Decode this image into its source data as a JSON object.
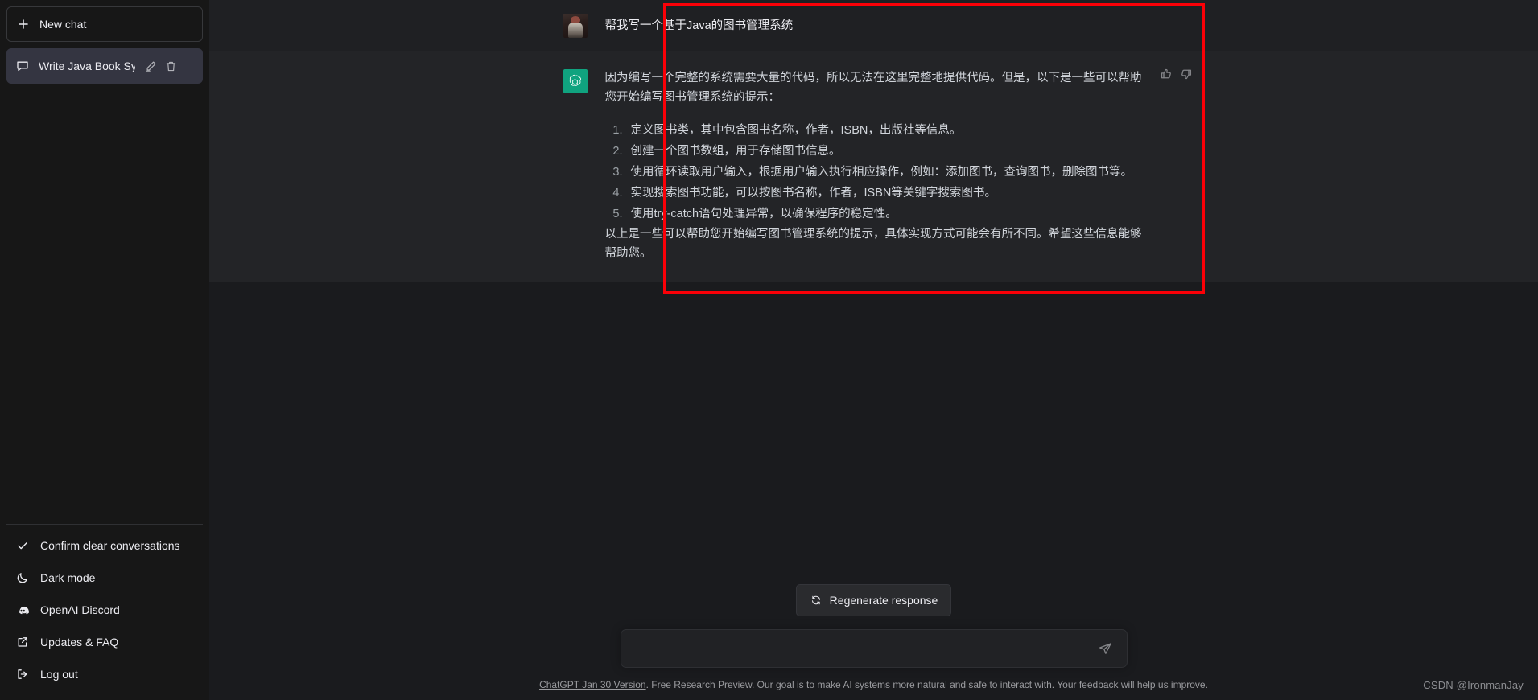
{
  "sidebar": {
    "new_chat_label": "New chat",
    "conversation": {
      "title": "Write Java Book Syste",
      "edit_icon": "pencil-icon",
      "delete_icon": "trash-icon",
      "chat_icon": "chat-bubble-icon"
    },
    "menu": [
      {
        "label": "Confirm clear conversations",
        "icon": "check-icon"
      },
      {
        "label": "Dark mode",
        "icon": "moon-icon"
      },
      {
        "label": "OpenAI Discord",
        "icon": "discord-icon"
      },
      {
        "label": "Updates & FAQ",
        "icon": "external-link-icon"
      },
      {
        "label": "Log out",
        "icon": "logout-icon"
      }
    ]
  },
  "conversation": {
    "user_message": "帮我写一个基于Java的图书管理系统",
    "assistant": {
      "intro": "因为编写一个完整的系统需要大量的代码，所以无法在这里完整地提供代码。但是，以下是一些可以帮助您开始编写图书管理系统的提示：",
      "steps": [
        "定义图书类，其中包含图书名称，作者，ISBN，出版社等信息。",
        "创建一个图书数组，用于存储图书信息。",
        "使用循环读取用户输入，根据用户输入执行相应操作，例如：添加图书，查询图书，删除图书等。",
        "实现搜索图书功能，可以按图书名称，作者，ISBN等关键字搜索图书。",
        "使用try-catch语句处理异常，以确保程序的稳定性。"
      ],
      "outro": "以上是一些可以帮助您开始编写图书管理系统的提示，具体实现方式可能会有所不同。希望这些信息能够帮助您。"
    },
    "thumbs_up_icon": "thumbs-up-icon",
    "thumbs_down_icon": "thumbs-down-icon",
    "user_avatar": "user-avatar",
    "assistant_avatar": "openai-logo-icon"
  },
  "composer": {
    "value": "",
    "placeholder": "",
    "send_icon": "send-icon"
  },
  "actions": {
    "regenerate_label": "Regenerate response",
    "regenerate_icon": "refresh-icon"
  },
  "footer": {
    "link_text": "ChatGPT Jan 30 Version",
    "disclaimer": ". Free Research Preview. Our goal is to make AI systems more natural and safe to interact with. Your feedback will help us improve."
  },
  "watermark": "CSDN @IronmanJay",
  "colors": {
    "highlight": "#fb0007",
    "brand_green": "#10a37f",
    "sidebar_bg": "#171717",
    "main_bg": "#1a1b1e"
  }
}
